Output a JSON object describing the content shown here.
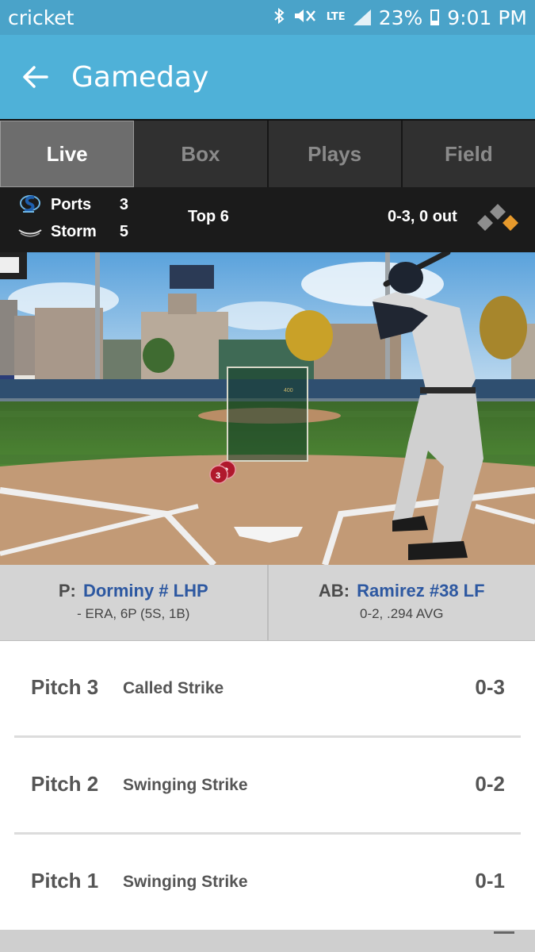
{
  "status": {
    "carrier": "cricket",
    "network": "LTE",
    "battery": "23%",
    "time": "9:01 PM"
  },
  "app_bar": {
    "title": "Gameday"
  },
  "tabs": [
    {
      "label": "Live",
      "active": true
    },
    {
      "label": "Box",
      "active": false
    },
    {
      "label": "Plays",
      "active": false
    },
    {
      "label": "Field",
      "active": false
    }
  ],
  "scoreboard": {
    "teams": [
      {
        "name": "Ports",
        "score": "3"
      },
      {
        "name": "Storm",
        "score": "5"
      }
    ],
    "inning": "Top 6",
    "count": "0-3, 0 out"
  },
  "field": {
    "pitch_markers": [
      "3",
      "2"
    ],
    "strike_zone_label": "400"
  },
  "matchup": {
    "pitcher": {
      "prefix": "P:",
      "name": "Dorminy # LHP",
      "stats": "- ERA, 6P (5S, 1B)"
    },
    "batter": {
      "prefix": "AB:",
      "name": "Ramirez #38 LF",
      "stats": "0-2, .294 AVG"
    }
  },
  "pitches": [
    {
      "label": "Pitch 3",
      "result": "Called Strike",
      "count": "0-3"
    },
    {
      "label": "Pitch 2",
      "result": "Swinging Strike",
      "count": "0-2"
    },
    {
      "label": "Pitch 1",
      "result": "Swinging Strike",
      "count": "0-1"
    }
  ],
  "colors": {
    "status_bar": "#4aa3c9",
    "app_bar": "#4fb1d8",
    "player_link": "#2d58a1",
    "pitch_marker": "#b0182c"
  }
}
